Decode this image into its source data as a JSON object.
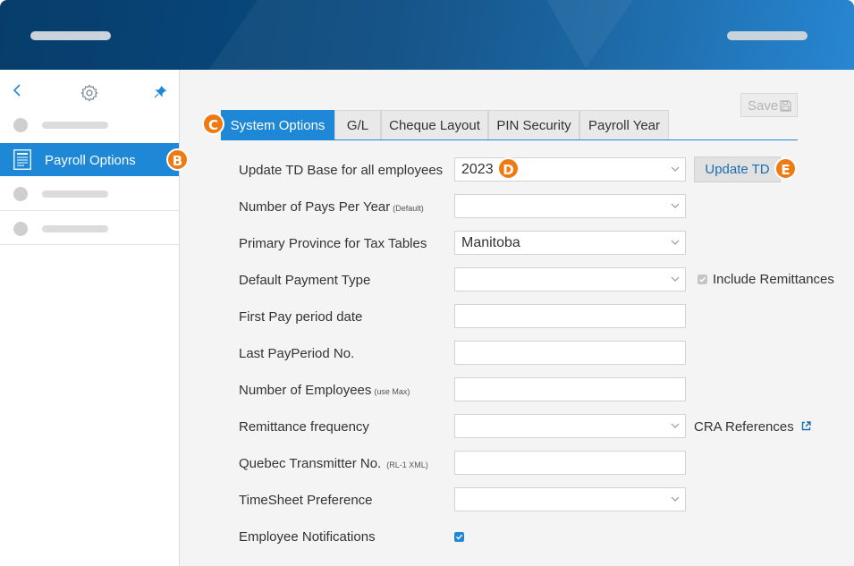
{
  "sidebar": {
    "active_item": "Payroll Options",
    "badge_b": "B"
  },
  "toolbar": {
    "save_label": "Save"
  },
  "tabs": [
    {
      "label": "System Options",
      "active": true
    },
    {
      "label": "G/L",
      "active": false
    },
    {
      "label": "Cheque Layout",
      "active": false
    },
    {
      "label": "PIN Security",
      "active": false
    },
    {
      "label": "Payroll Year",
      "active": false
    }
  ],
  "badges": {
    "c": "C",
    "d": "D",
    "e": "E"
  },
  "form": {
    "update_td": {
      "label": "Update TD Base for all employees",
      "value": "2023",
      "button": "Update TD"
    },
    "pays_per_year": {
      "label": "Number of Pays Per Year",
      "note": "(Default)",
      "value": ""
    },
    "province": {
      "label": "Primary Province for Tax Tables",
      "value": "Manitoba"
    },
    "payment_type": {
      "label": "Default Payment Type",
      "value": "",
      "include_remittances": "Include Remittances",
      "include_remittances_checked": true
    },
    "first_pay_date": {
      "label": "First Pay period date",
      "value": ""
    },
    "last_period": {
      "label": "Last PayPeriod No.",
      "value": ""
    },
    "num_employees": {
      "label": "Number of Employees",
      "note": "(use Max)",
      "value": ""
    },
    "remittance_freq": {
      "label": "Remittance frequency",
      "value": "",
      "cra_link": "CRA References"
    },
    "quebec": {
      "label": "Quebec Transmitter No.",
      "note": "(RL-1 XML)",
      "value": ""
    },
    "timesheet": {
      "label": "TimeSheet Preference",
      "value": ""
    },
    "notifications": {
      "label": "Employee Notifications",
      "checked": true
    }
  },
  "colors": {
    "accent": "#1e88d6",
    "badge": "#f07a12",
    "header_dark": "#063d6b"
  }
}
